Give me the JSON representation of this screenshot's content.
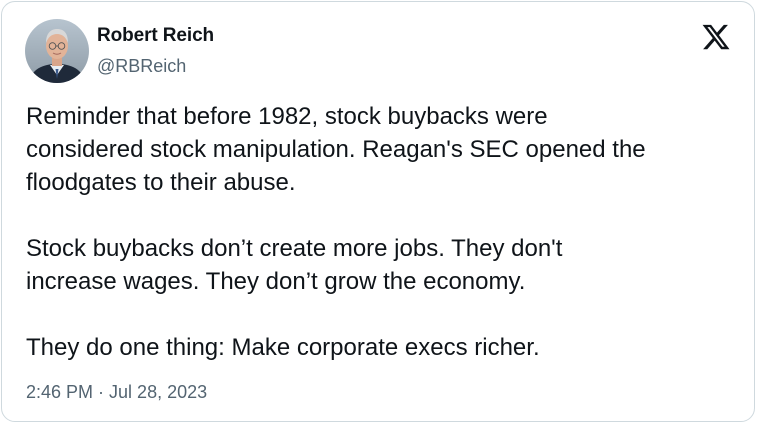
{
  "author": {
    "name": "Robert Reich",
    "handle": "@RBReich"
  },
  "logo_icon": "x-logo-icon",
  "tweet": {
    "paragraphs": [
      "Reminder that before 1982, stock buybacks were\nconsidered stock manipulation. Reagan's SEC opened the\nfloodgates to their abuse.",
      "Stock buybacks don’t create more jobs. They don't\nincrease wages. They don’t grow the economy.",
      "They do one thing: Make corporate execs richer."
    ],
    "time": "2:46 PM",
    "separator": " · ",
    "date": "Jul 28, 2023"
  },
  "colors": {
    "text_primary": "#0f1419",
    "text_secondary": "#536471",
    "border": "#cfd9de"
  }
}
